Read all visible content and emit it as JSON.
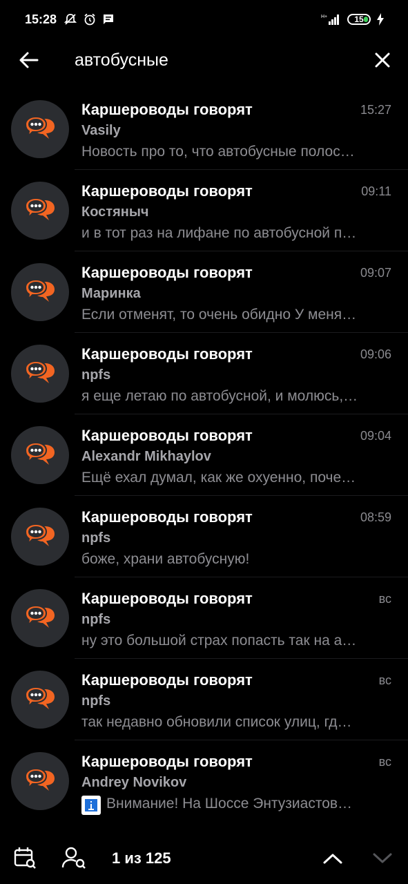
{
  "status_bar": {
    "time": "15:28",
    "battery_level": "15",
    "icons": [
      "mute-bell-icon",
      "alarm-icon",
      "message-icon",
      "signal-icon",
      "battery-icon",
      "charging-icon"
    ]
  },
  "search": {
    "query": "автобусные",
    "icons": [
      "back-arrow-icon",
      "close-icon"
    ]
  },
  "results": [
    {
      "title": "Каршероводы говорят",
      "time": "15:27",
      "sender": "Vasily",
      "text": "Новость про то, что автобусные полос…"
    },
    {
      "title": "Каршероводы говорят",
      "time": "09:11",
      "sender": "Костяныч",
      "text": "и в тот раз на лифане по автобусной п…"
    },
    {
      "title": "Каршероводы говорят",
      "time": "09:07",
      "sender": "Маринка",
      "text": "Если отменят, то очень обидно У меня…"
    },
    {
      "title": "Каршероводы говорят",
      "time": "09:06",
      "sender": "npfs",
      "text": "я еще летаю по автобусной, и молюсь,…"
    },
    {
      "title": "Каршероводы говорят",
      "time": "09:04",
      "sender": "Alexandr Mikhaylov",
      "text": "Ещё ехал думал, как же охуенно, поче…"
    },
    {
      "title": "Каршероводы говорят",
      "time": "08:59",
      "sender": "npfs",
      "text": "боже, храни автобусную!"
    },
    {
      "title": "Каршероводы говорят",
      "time": "вс",
      "sender": "npfs",
      "text": "ну это большой страх попасть так на а…"
    },
    {
      "title": "Каршероводы говорят",
      "time": "вс",
      "sender": "npfs",
      "text": "так недавно обновили список улиц, гд…"
    },
    {
      "title": "Каршероводы говорят",
      "time": "вс",
      "sender": "Andrey Novikov",
      "text": "Внимание! На Шоссе Энтузиастов…",
      "has_thumbnail": true
    }
  ],
  "bottom_bar": {
    "counter": "1 из 125",
    "icons": [
      "calendar-search-icon",
      "user-search-icon",
      "chevron-up-icon",
      "chevron-down-icon"
    ]
  },
  "colors": {
    "background": "#000000",
    "avatar_bg": "#2b2d31",
    "avatar_accent": "#f26522",
    "secondary_text": "#8d8d92"
  }
}
